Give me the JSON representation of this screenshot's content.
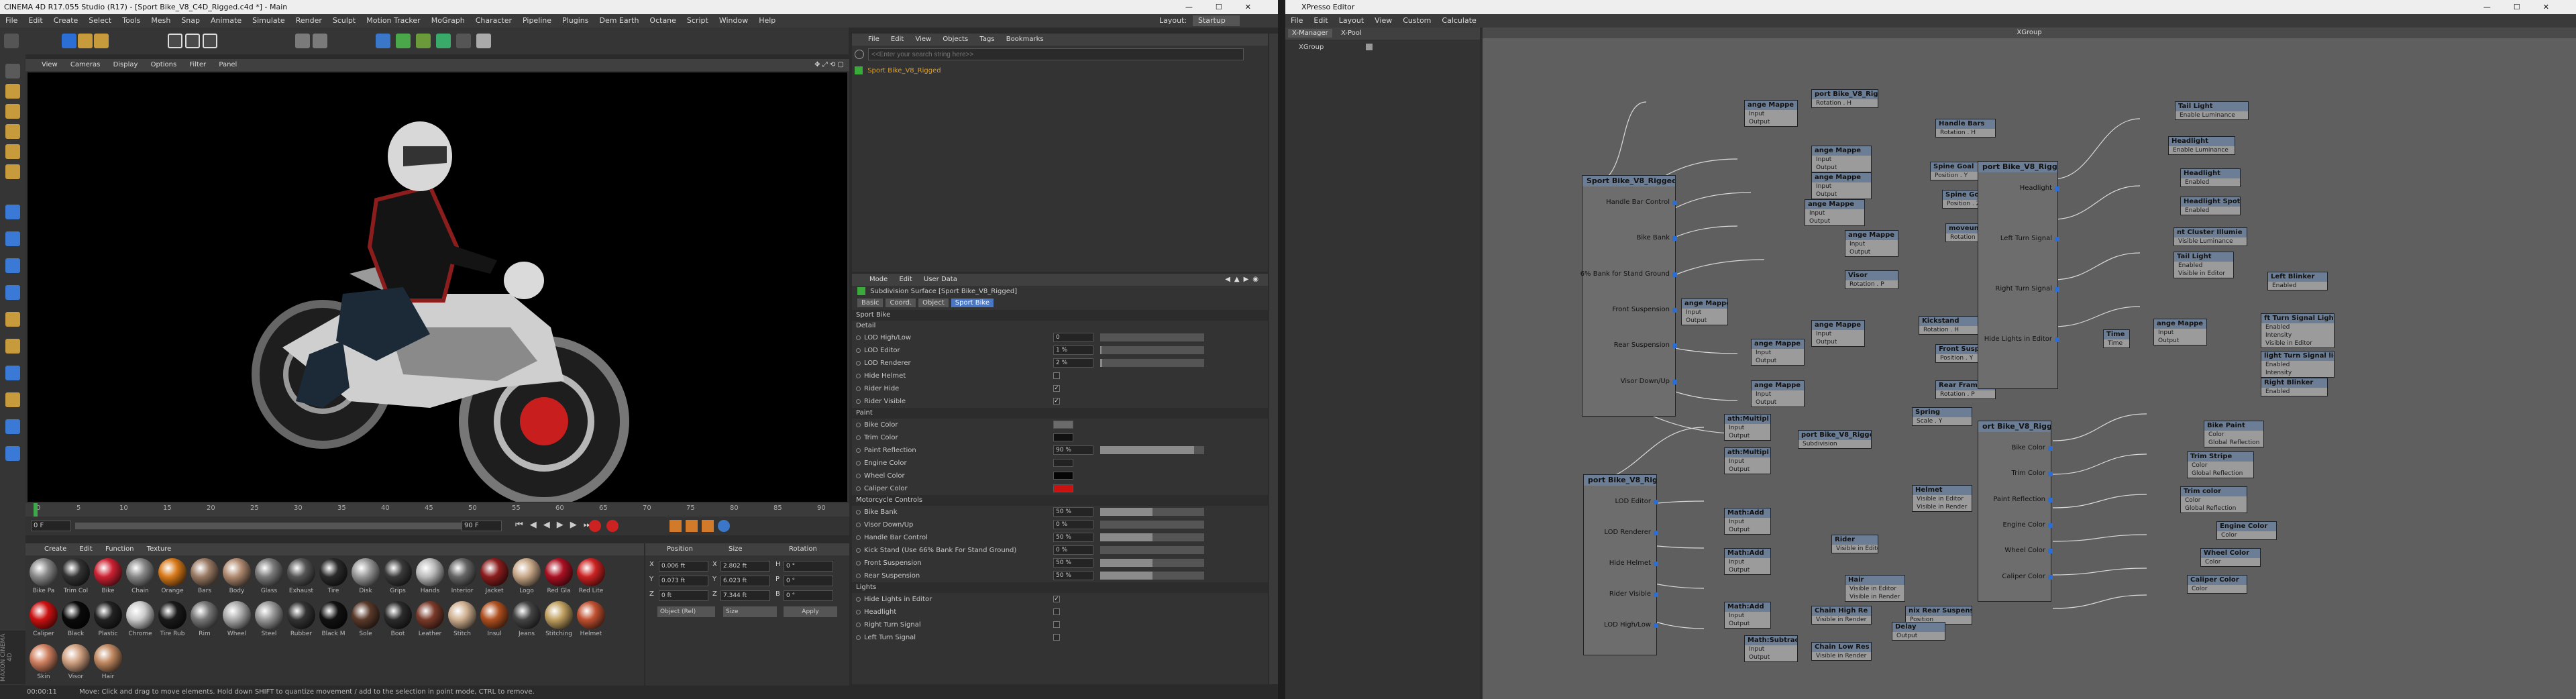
{
  "c4d": {
    "title": "CINEMA 4D R17.055 Studio (R17) - [Sport Bike_V8_C4D_Rigged.c4d *] - Main",
    "menu": [
      "File",
      "Edit",
      "Create",
      "Select",
      "Tools",
      "Mesh",
      "Snap",
      "Animate",
      "Simulate",
      "Render",
      "Sculpt",
      "Motion Tracker",
      "MoGraph",
      "Character",
      "Pipeline",
      "Plugins",
      "Dem Earth",
      "Octane",
      "Script",
      "Window",
      "Help"
    ],
    "layout_label": "Layout:",
    "layout_value": "Startup",
    "viewport_menu": [
      "View",
      "Cameras",
      "Display",
      "Options",
      "Filter",
      "Panel"
    ],
    "timeline_ticks": [
      "0",
      "5",
      "10",
      "15",
      "20",
      "25",
      "30",
      "35",
      "40",
      "45",
      "50",
      "55",
      "60",
      "65",
      "70",
      "75",
      "80",
      "85",
      "90"
    ],
    "frame_start": "0 F",
    "frame_end": "90 F",
    "frame_cur": "0 F",
    "objects_menu": [
      "File",
      "Edit",
      "View",
      "Objects",
      "Tags",
      "Bookmarks"
    ],
    "search_placeholder": "<<Enter your search string here>>",
    "object_name": "Sport Bike_V8_Rigged",
    "attr_menu": [
      "Mode",
      "Edit",
      "User Data"
    ],
    "attr_title": "Subdivision Surface [Sport Bike_V8_Rigged]",
    "attr_tabs": [
      "Basic",
      "Coord.",
      "Object",
      "Sport Bike"
    ],
    "sections": {
      "sport_bike": "Sport Bike",
      "detail": "Detail",
      "paint": "Paint",
      "moto": "Motorcycle Controls",
      "lights": "Lights"
    },
    "detail_rows": [
      {
        "label": "LOD High/Low",
        "value": "0",
        "fill": 0
      },
      {
        "label": "LOD Editor",
        "value": "1 %",
        "fill": 0.01
      },
      {
        "label": "LOD Renderer",
        "value": "2 %",
        "fill": 0.02
      }
    ],
    "detail_checks": [
      {
        "label": "Hide Helmet",
        "checked": false
      },
      {
        "label": "Rider Hide",
        "checked": true
      },
      {
        "label": "Rider Visible",
        "checked": true
      }
    ],
    "paint_rows": [
      {
        "label": "Bike Color",
        "color": "#6b6b6b"
      },
      {
        "label": "Trim Color",
        "color": "#111111"
      },
      {
        "label": "Paint Reflection",
        "value": "90 %",
        "fill": 0.9
      },
      {
        "label": "Engine Color",
        "color": "#222222"
      },
      {
        "label": "Wheel Color",
        "color": "#050505"
      },
      {
        "label": "Caliper Color",
        "color": "#cc1111"
      }
    ],
    "moto_rows": [
      {
        "label": "Bike Bank",
        "value": "50 %",
        "fill": 0.5
      },
      {
        "label": "Visor Down/Up",
        "value": "0 %",
        "fill": 0
      },
      {
        "label": "Handle Bar Control",
        "value": "50 %",
        "fill": 0.5
      },
      {
        "label": "Kick Stand (Use 66% Bank For Stand Ground)",
        "value": "0 %",
        "fill": 0
      },
      {
        "label": "Front Suspension",
        "value": "50 %",
        "fill": 0.5
      },
      {
        "label": "Rear Suspension",
        "value": "50 %",
        "fill": 0.5
      }
    ],
    "light_rows": [
      {
        "label": "Hide Lights in Editor",
        "checked": true
      },
      {
        "label": "Headlight",
        "checked": false
      },
      {
        "label": "Right Turn Signal",
        "checked": false
      },
      {
        "label": "Left Turn Signal",
        "checked": false
      }
    ],
    "coord_headers": [
      "Position",
      "Size",
      "Rotation"
    ],
    "coords": [
      [
        "X",
        "0.006 ft",
        "X",
        "2.802 ft",
        "H",
        "0 °"
      ],
      [
        "Y",
        "0.073 ft",
        "Y",
        "6.023 ft",
        "P",
        "0 °"
      ],
      [
        "Z",
        "0 ft",
        "Z",
        "7.344 ft",
        "B",
        "0 °"
      ]
    ],
    "coord_mode": "Object (Rel)",
    "coord_size": "Size",
    "apply": "Apply",
    "mat_menu": [
      "Create",
      "Edit",
      "Function",
      "Texture"
    ],
    "materials": [
      {
        "name": "Bike Pa",
        "color": "#8a8a8a"
      },
      {
        "name": "Trim Col",
        "color": "#333"
      },
      {
        "name": "Bike",
        "color": "#c23"
      },
      {
        "name": "Chain",
        "color": "#888"
      },
      {
        "name": "Orange",
        "color": "#d87a1a"
      },
      {
        "name": "Bars",
        "color": "#9a7a64"
      },
      {
        "name": "Body",
        "color": "#b08a70"
      },
      {
        "name": "Glass",
        "color": "#7a7a7a"
      },
      {
        "name": "Exhaust",
        "color": "#555"
      },
      {
        "name": "Tire",
        "color": "#2a2a2a"
      },
      {
        "name": "Disk",
        "color": "#999"
      },
      {
        "name": "Grips",
        "color": "#3a3a3a"
      },
      {
        "name": "Hands",
        "color": "#bbb"
      },
      {
        "name": "Interior",
        "color": "#666"
      },
      {
        "name": "Jacket",
        "color": "#8b1d1d"
      },
      {
        "name": "Logo",
        "color": "#c8a888"
      },
      {
        "name": "Red Gla",
        "color": "#aa1122"
      },
      {
        "name": "Red Lite",
        "color": "#cc2222"
      },
      {
        "name": "Caliper",
        "color": "#cc1111"
      },
      {
        "name": "Black",
        "color": "#0a0a0a"
      },
      {
        "name": "Plastic",
        "color": "#222"
      },
      {
        "name": "Chrome",
        "color": "#ccc"
      },
      {
        "name": "Tire Rub",
        "color": "#1a1a1a"
      },
      {
        "name": "Rim",
        "color": "#777"
      },
      {
        "name": "Wheel",
        "color": "#aaa"
      },
      {
        "name": "Steel",
        "color": "#999"
      },
      {
        "name": "Rubber",
        "color": "#333"
      },
      {
        "name": "Black M",
        "color": "#111"
      },
      {
        "name": "Sole",
        "color": "#5a3a2a"
      },
      {
        "name": "Boot",
        "color": "#2b2b2b"
      },
      {
        "name": "Leather",
        "color": "#7a3a2a"
      },
      {
        "name": "Stitch",
        "color": "#d0b090"
      },
      {
        "name": "Insul",
        "color": "#b05020"
      },
      {
        "name": "Jeans",
        "color": "#444"
      },
      {
        "name": "Stitching",
        "color": "#c0a060"
      },
      {
        "name": "Helmet",
        "color": "#c05030"
      },
      {
        "name": "Skin",
        "color": "#d08060"
      },
      {
        "name": "Visor",
        "color": "#d0a080"
      },
      {
        "name": "Hair",
        "color": "#c08860"
      }
    ],
    "status": "Move: Click and drag to move elements. Hold down SHIFT to quantize movement / add to the selection in point mode, CTRL to remove.",
    "status_time": "00:00:11"
  },
  "xpresso": {
    "title": "XPresso Editor",
    "menu": [
      "File",
      "Edit",
      "Layout",
      "View",
      "Custom",
      "Calculate"
    ],
    "tabs": [
      "X-Manager",
      "X-Pool"
    ],
    "tree_item": "XGroup",
    "canvas_title": "XGroup",
    "nodes": [
      {
        "title": "ange Mappe",
        "rows": [
          "Input",
          "Output"
        ]
      },
      {
        "title": "port Bike_V8_Rigge",
        "rows": [
          "Rotation . H"
        ]
      },
      {
        "title": "Handle Bars",
        "rows": [
          "Rotation . H"
        ]
      },
      {
        "title": "ange Mappe",
        "rows": [
          "Input",
          "Output"
        ]
      },
      {
        "title": "Spine Goal",
        "rows": [
          "Position . Y"
        ]
      },
      {
        "title": "ange Mappe",
        "rows": [
          "Input",
          "Output"
        ]
      },
      {
        "title": "Spine Goal",
        "rows": [
          "Position . Z"
        ]
      },
      {
        "title": "ange Mappe",
        "rows": [
          "Input",
          "Output"
        ]
      },
      {
        "title": "ange Mappe",
        "rows": [
          "Input",
          "Output"
        ]
      },
      {
        "title": "moveumpNeck",
        "rows": [
          "Rotation . H"
        ]
      },
      {
        "title": "Visor",
        "rows": [
          "Rotation . P"
        ]
      },
      {
        "title": "ange Mappe",
        "rows": [
          "Input",
          "Output"
        ]
      },
      {
        "title": "Kickstand",
        "rows": [
          "Rotation . H"
        ]
      },
      {
        "title": "ange Mappe",
        "rows": [
          "Input",
          "Output"
        ]
      },
      {
        "title": "Front Suspension",
        "rows": [
          "Position . Y"
        ]
      },
      {
        "title": "ange Mappe",
        "rows": [
          "Input",
          "Output"
        ]
      },
      {
        "title": "Rear Frame",
        "rows": [
          "Rotation . P"
        ]
      },
      {
        "title": "ange Mappe",
        "rows": [
          "Input",
          "Output"
        ]
      },
      {
        "title": "Spring",
        "rows": [
          "Scale . Y"
        ]
      },
      {
        "title": "ath:Multipl",
        "rows": [
          "Input",
          "Output"
        ]
      },
      {
        "title": "port Bike_V8_Rigge",
        "rows": [
          "Subdivision"
        ]
      },
      {
        "title": "ath:Multipl",
        "rows": [
          "Input",
          "Output"
        ]
      },
      {
        "title": "Helmet",
        "rows": [
          "Visible in Editor",
          "Visible in Render"
        ]
      },
      {
        "title": "Math:Add",
        "rows": [
          "Input",
          "Output"
        ]
      },
      {
        "title": "Rider",
        "rows": [
          "Visible in Editor"
        ]
      },
      {
        "title": "Math:Add",
        "rows": [
          "Input",
          "Output"
        ]
      },
      {
        "title": "Hair",
        "rows": [
          "Visible in Editor",
          "Visible in Render"
        ]
      },
      {
        "title": "Math:Add",
        "rows": [
          "Input",
          "Output"
        ]
      },
      {
        "title": "Chain High Re",
        "rows": [
          "Visible in Render"
        ]
      },
      {
        "title": "nix Rear Suspens",
        "rows": [
          "Position"
        ]
      },
      {
        "title": "Math:Subtract",
        "rows": [
          "Input",
          "Output"
        ]
      },
      {
        "title": "Chain Low Res",
        "rows": [
          "Visible in Render"
        ]
      },
      {
        "title": "Delay",
        "rows": [
          "Output"
        ]
      },
      {
        "title": "Tail Light",
        "rows": [
          "Enable Luminance"
        ]
      },
      {
        "title": "Headlight",
        "rows": [
          "Enable Luminance"
        ]
      },
      {
        "title": "Headlight",
        "rows": [
          "Enabled"
        ]
      },
      {
        "title": "Headlight Spot",
        "rows": [
          "Enabled"
        ]
      },
      {
        "title": "nt Cluster Illumie",
        "rows": [
          "Visible Luminance"
        ]
      },
      {
        "title": "Tail Light",
        "rows": [
          "Enabled",
          "Visible in Editor"
        ]
      },
      {
        "title": "Left Blinker",
        "rows": [
          "Enabled"
        ]
      },
      {
        "title": "Time",
        "rows": [
          "Time"
        ]
      },
      {
        "title": "ange Mappe",
        "rows": [
          "Input",
          "Output"
        ]
      },
      {
        "title": "ft Turn Signal Light",
        "rows": [
          "Enabled",
          "Intensity",
          "Visible in Editor"
        ]
      },
      {
        "title": "light Turn Signal lig",
        "rows": [
          "Enabled",
          "Intensity"
        ]
      },
      {
        "title": "Right Blinker",
        "rows": [
          "Enabled"
        ]
      },
      {
        "title": "Bike Paint",
        "rows": [
          "Color",
          "Global Reflection"
        ]
      },
      {
        "title": "Trim Stripe",
        "rows": [
          "Color",
          "Global Reflection"
        ]
      },
      {
        "title": "Trim color",
        "rows": [
          "Color",
          "Global Reflection"
        ]
      },
      {
        "title": "Engine Color",
        "rows": [
          "Color"
        ]
      },
      {
        "title": "Wheel Color",
        "rows": [
          "Color"
        ]
      },
      {
        "title": "Caliper Color",
        "rows": [
          "Color"
        ]
      }
    ],
    "big_nodes": [
      {
        "title": "Sport Bike_V8_Rigged",
        "ports": [
          "Handle Bar Control",
          "Bike Bank",
          "6% Bank for Stand Ground",
          "Front Suspension",
          "Rear Suspension",
          "Visor Down/Up"
        ]
      },
      {
        "title": "port Bike_V8_Rigge",
        "ports": [
          "Headlight",
          "Left Turn Signal",
          "Right Turn Signal",
          "Hide Lights in Editor"
        ]
      },
      {
        "title": "port Bike_V8_Rigge",
        "ports": [
          "LOD Editor",
          "LOD Renderer",
          "Hide Helmet",
          "Rider Visible",
          "LOD High/Low"
        ]
      },
      {
        "title": "ort Bike_V8_Rigge",
        "ports": [
          "Bike Color",
          "Trim Color",
          "Paint Reflection",
          "Engine Color",
          "Wheel Color",
          "Caliper Color"
        ]
      }
    ]
  }
}
